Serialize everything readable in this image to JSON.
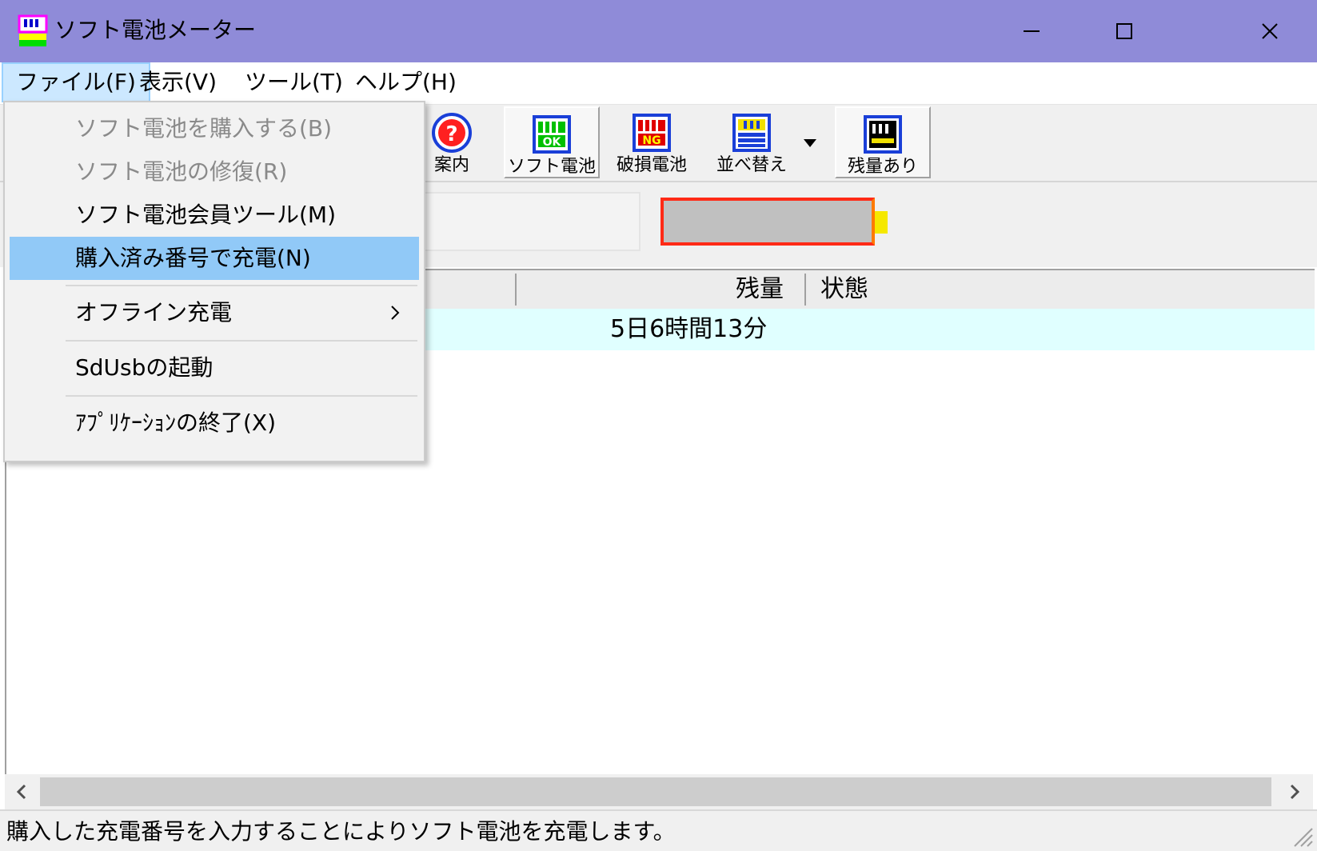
{
  "window": {
    "title": "ソフト電池メーター",
    "minimize_icon": "minimize-icon",
    "maximize_icon": "maximize-icon",
    "close_icon": "close-icon"
  },
  "menubar": {
    "items": [
      {
        "label": "ファイル(F)"
      },
      {
        "label": "表示(V)"
      },
      {
        "label": "ツール(T)"
      },
      {
        "label": "ヘルプ(H)"
      }
    ]
  },
  "toolbar": {
    "buttons": [
      {
        "label": "案内",
        "icon": "help-icon"
      },
      {
        "label": "ソフト電池",
        "icon": "battery-ok-icon"
      },
      {
        "label": "破損電池",
        "icon": "battery-ng-icon"
      },
      {
        "label": "並べ替え",
        "icon": "sort-icon"
      },
      {
        "label": "残量あり",
        "icon": "battery-remaining-icon"
      }
    ]
  },
  "list": {
    "columns": [
      "残量",
      "状態"
    ],
    "rows": [
      {
        "remaining": "5日6時間13分",
        "status": ""
      }
    ]
  },
  "file_menu": {
    "items": [
      {
        "label": "ソフト電池を購入する(B)",
        "enabled": false
      },
      {
        "label": "ソフト電池の修復(R)",
        "enabled": false
      },
      {
        "label": "ソフト電池会員ツール(M)",
        "enabled": true
      },
      {
        "label": "購入済み番号で充電(N)",
        "enabled": true,
        "highlighted": true
      },
      {
        "label": "オフライン充電",
        "enabled": true,
        "submenu": true
      },
      {
        "label": "SdUsbの起動",
        "enabled": true
      },
      {
        "label": "ｱﾌﾟﾘｹｰｼｮﾝの終了(X)",
        "enabled": true
      }
    ]
  },
  "statusbar": {
    "text": "購入した充電番号を入力することによりソフト電池を充電します。"
  },
  "colors": {
    "titlebar": "#8f8bd8",
    "menu_highlight": "#91c9f7",
    "row_highlight": "#e0ffff",
    "battery_border": "#ff2a16",
    "battery_tip": "#f5e800"
  }
}
